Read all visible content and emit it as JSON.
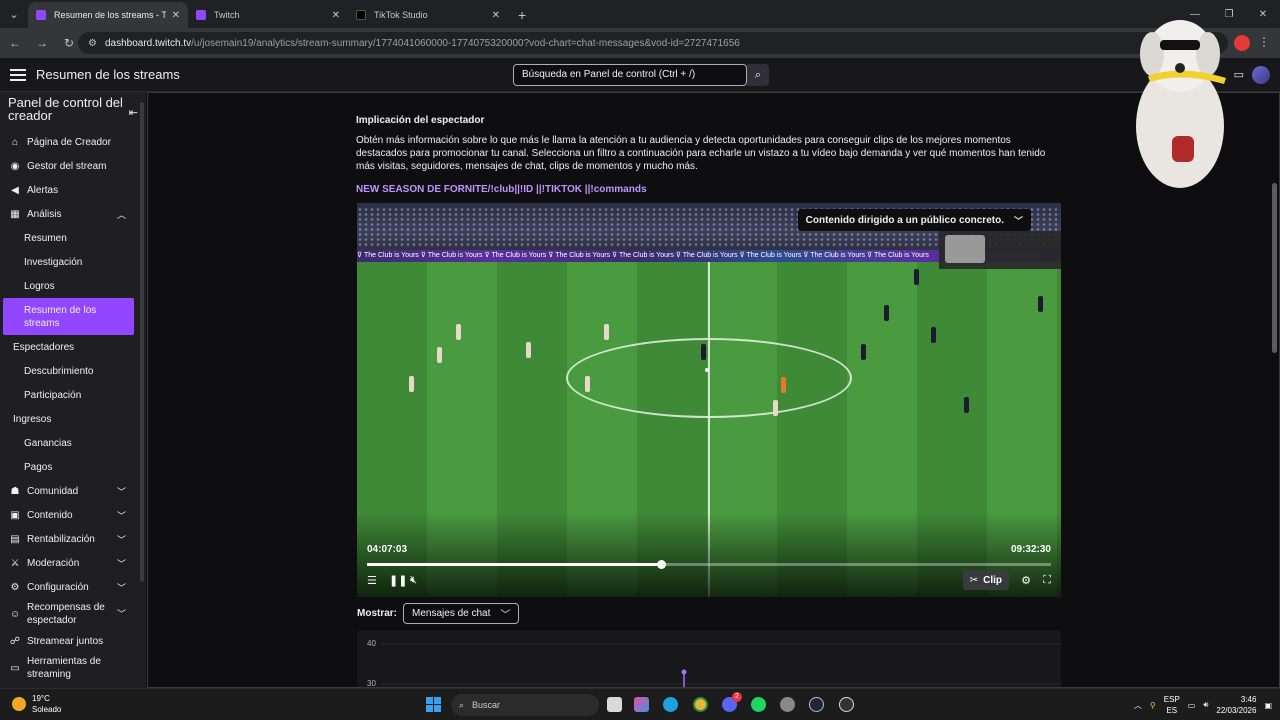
{
  "browser": {
    "tabs": [
      {
        "title": "Resumen de los streams - Twitc",
        "close": "✕",
        "active": true
      },
      {
        "title": "Twitch",
        "close": "✕",
        "active": false
      },
      {
        "title": "TikTok Studio",
        "close": "✕",
        "active": false
      }
    ],
    "new_tab": "+",
    "url_host": "dashboard.twitch.tv",
    "url_path": "/u/josemain19/analytics/stream-summary/1774041060000-1774075320000?vod-chart=chat-messages&vod-id=2727471656"
  },
  "topnav": {
    "title": "Resumen de los streams",
    "search_placeholder": "Búsqueda en Panel de control (Ctrl + /)"
  },
  "sidebar": {
    "title": "Panel de control del creador",
    "items": [
      {
        "label": "Página de Creador",
        "icon": "home-icon"
      },
      {
        "label": "Gestor del stream",
        "icon": "broadcast-icon"
      },
      {
        "label": "Alertas",
        "icon": "megaphone-icon"
      },
      {
        "label": "Análisis",
        "icon": "analytics-icon"
      }
    ],
    "analytics_sub": [
      "Resumen",
      "Investigación",
      "Logros",
      "Resumen de los streams"
    ],
    "group_viewers": "Espectadores",
    "viewers_sub": [
      "Descubrimiento",
      "Participación"
    ],
    "group_revenue": "Ingresos",
    "revenue_sub": [
      "Ganancias",
      "Pagos"
    ],
    "bottom_items": [
      {
        "label": "Comunidad",
        "icon": "community-icon"
      },
      {
        "label": "Contenido",
        "icon": "content-icon"
      },
      {
        "label": "Rentabilización",
        "icon": "money-icon"
      },
      {
        "label": "Moderación",
        "icon": "sword-icon"
      },
      {
        "label": "Configuración",
        "icon": "gear-icon"
      },
      {
        "label": "Recompensas de espectador",
        "icon": "rewards-icon"
      },
      {
        "label": "Streamear juntos",
        "icon": "people-icon"
      },
      {
        "label": "Herramientas de streaming",
        "icon": "tools-icon"
      }
    ]
  },
  "main": {
    "section_title": "Implicación del espectador",
    "section_desc": "Obtén más información sobre lo que más le llama la atención a tu audiencia y detecta oportunidades para conseguir clips de los mejores momentos destacados para promocionar tu canal. Selecciona un filtro a continuación para echarle un vistazo a tu vídeo bajo demanda y ver qué momentos han tenido más visitas, seguidores, mensajes de chat, clips de momentos y mucho más.",
    "stream_title": "NEW SEASON DE FORNITE/!club||!ID ||!TIKTOK ||!commands",
    "player": {
      "notice": "Contenido dirigido a un público concreto.",
      "adboard_text": "The Club is Yours",
      "time_current": "04:07:03",
      "time_total": "09:32:30",
      "progress": 0.43,
      "clip_label": "Clip"
    },
    "show_label": "Mostrar:",
    "show_select": "Mensajes de chat"
  },
  "chart_data": {
    "type": "line",
    "y_ticks": [
      "40",
      "30"
    ]
  },
  "taskbar": {
    "weather_temp": "19°C",
    "weather_desc": "Soleado",
    "search_label": "Buscar",
    "lang_1": "ESP",
    "lang_2": "ES",
    "time": "3:46",
    "date": "22/03/2026",
    "badge": "2"
  }
}
